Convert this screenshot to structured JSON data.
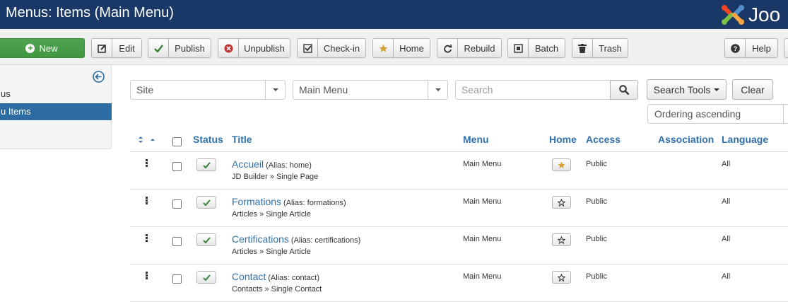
{
  "header": {
    "title": "Menus: Items (Main Menu)",
    "brand_text": "Joo"
  },
  "toolbar": {
    "new_label": "New",
    "buttons": [
      {
        "label": "Edit",
        "icon": "edit-icon"
      },
      {
        "label": "Publish",
        "icon": "check-icon"
      },
      {
        "label": "Unpublish",
        "icon": "unpublish-icon"
      },
      {
        "label": "Check-in",
        "icon": "checkin-icon"
      },
      {
        "label": "Home",
        "icon": "star-icon"
      },
      {
        "label": "Rebuild",
        "icon": "refresh-icon"
      },
      {
        "label": "Batch",
        "icon": "batch-icon"
      },
      {
        "label": "Trash",
        "icon": "trash-icon"
      }
    ],
    "help_label": "Help"
  },
  "sidebar": {
    "items": [
      {
        "label": "us"
      },
      {
        "label": "u Items",
        "active": true
      }
    ]
  },
  "filters": {
    "client": "Site",
    "menu": "Main Menu",
    "search_placeholder": "Search",
    "search_tools_label": "Search Tools",
    "clear_label": "Clear",
    "ordering": "Ordering ascending"
  },
  "table": {
    "headers": {
      "status": "Status",
      "title": "Title",
      "menu": "Menu",
      "home": "Home",
      "access": "Access",
      "association": "Association",
      "language": "Language"
    },
    "rows": [
      {
        "title": "Accueil",
        "alias": "(Alias: home)",
        "type": "JD Builder » Single Page",
        "menu": "Main Menu",
        "home": true,
        "access": "Public",
        "language": "All"
      },
      {
        "title": "Formations",
        "alias": "(Alias: formations)",
        "type": "Articles » Single Article",
        "menu": "Main Menu",
        "home": false,
        "access": "Public",
        "language": "All"
      },
      {
        "title": "Certifications",
        "alias": "(Alias: certifications)",
        "type": "Articles » Single Article",
        "menu": "Main Menu",
        "home": false,
        "access": "Public",
        "language": "All"
      },
      {
        "title": "Contact",
        "alias": "(Alias: contact)",
        "type": "Contacts » Single Contact",
        "menu": "Main Menu",
        "home": false,
        "access": "Public",
        "language": "All"
      }
    ]
  },
  "colors": {
    "header_bg": "#1a3867",
    "new_button": "#46a046",
    "link": "#3071a9",
    "active_sidebar": "#2d6ca2",
    "home_star": "#d69e2e",
    "publish_check": "#378137"
  }
}
